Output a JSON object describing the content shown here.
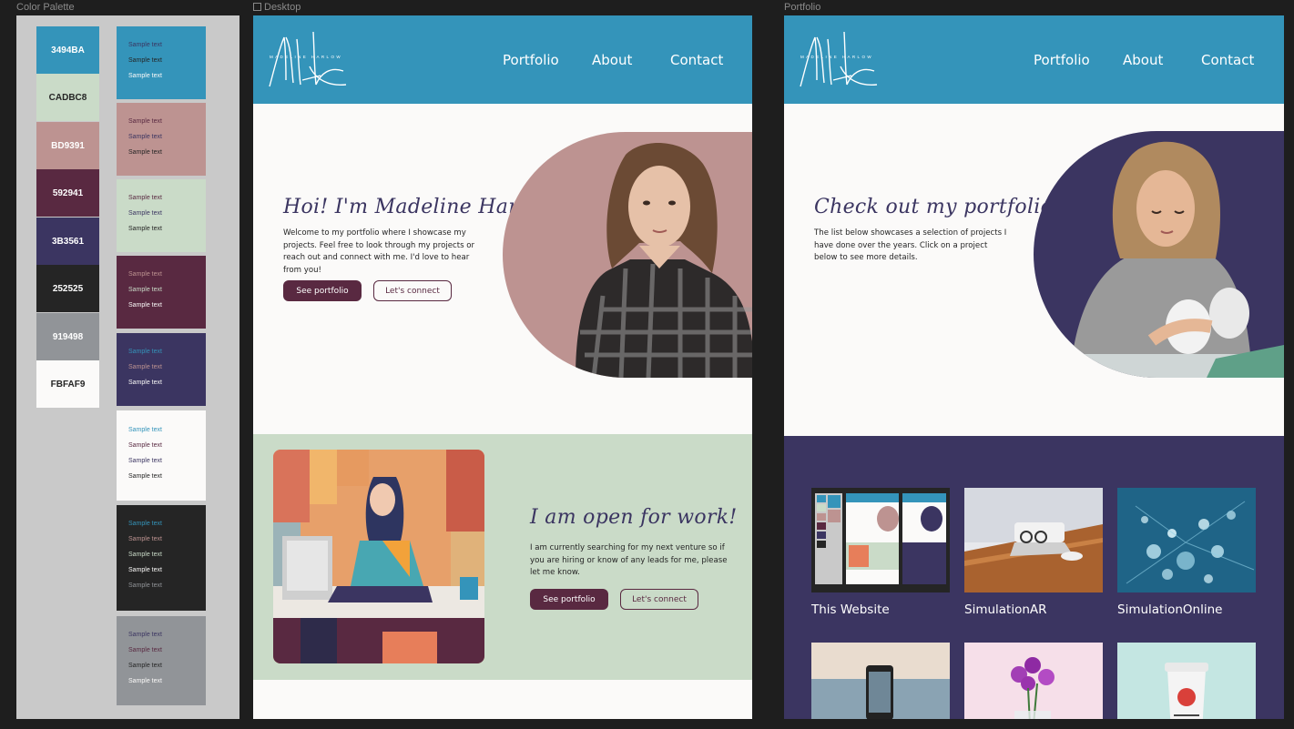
{
  "frames": {
    "palette_label": "Color Palette",
    "desktop_label": "Desktop",
    "portfolio_label": "Portfolio"
  },
  "palette": {
    "swatches": [
      {
        "hex": "3494BA",
        "color": "#3494BA",
        "text": "#ffffff"
      },
      {
        "hex": "CADBC8",
        "color": "#CADBC8",
        "text": "#252525"
      },
      {
        "hex": "BD9391",
        "color": "#BD9391",
        "text": "#ffffff"
      },
      {
        "hex": "592941",
        "color": "#592941",
        "text": "#ffffff"
      },
      {
        "hex": "3B3561",
        "color": "#3B3561",
        "text": "#ffffff"
      },
      {
        "hex": "252525",
        "color": "#252525",
        "text": "#ffffff"
      },
      {
        "hex": "919498",
        "color": "#919498",
        "text": "#ffffff"
      },
      {
        "hex": "FBFAF9",
        "color": "#FBFAF9",
        "text": "#252525"
      }
    ],
    "sample_text": "Sample text"
  },
  "site": {
    "nav": [
      "Portfolio",
      "About",
      "Contact"
    ],
    "logo_text": "MADELINE HARLOW"
  },
  "desktop": {
    "hero_title": "Hoi! I'm Madeline Harlow",
    "hero_text": "Welcome to my portfolio where I showcase my projects. Feel free to look through my projects or reach out and connect with me. I'd love to hear from you!",
    "btn_portfolio": "See portfolio",
    "btn_connect": "Let's connect",
    "work_title": "I am open for work!",
    "work_text": "I am currently searching for my next venture so if you are hiring or know of any leads for me, please let me know.",
    "work_btn_portfolio": "See portfolio",
    "work_btn_connect": "Let's connect"
  },
  "portfolio": {
    "hero_title": "Check out my portfolio",
    "hero_text": "The list below showcases a selection of projects I have done over the years. Click on a project below to see more details.",
    "projects": [
      {
        "title": "This Website"
      },
      {
        "title": "SimulationAR"
      },
      {
        "title": "SimulationOnline"
      }
    ]
  }
}
